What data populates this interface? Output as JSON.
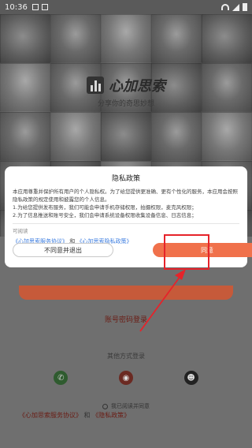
{
  "status_bar": {
    "time": "10:36"
  },
  "background": {
    "app_name": "心加思索",
    "tagline": "分享你的奇思妙想",
    "account_login": "账号密码登录",
    "other_login": "其他方式登录",
    "agree_text": "我已阅读并同意",
    "bottom_link1": "《心加思索服务协议》",
    "bottom_and": "和",
    "bottom_link2": "《隐私政策》",
    "social_icons": [
      "wechat-icon",
      "weibo-icon",
      "qq-icon"
    ]
  },
  "dialog": {
    "title": "隐私政策",
    "body": [
      "本应用尊重并保护所有用户的个人隐私权。为了给您提供更准确、更有个性化的服务，本应用会按照隐私政策的规定使用和披露您的个人信息。",
      "1.为给您提供发布服务，我们可能会申请手机存储权限，拍摄权限，麦克风权限；",
      "2.为了信息推送和账号安全，我们会申请系统设备权限收集设备信息、日志信息；"
    ],
    "read_label": "可阅读",
    "link1": "《心加思索服务协议》",
    "and": "和",
    "link2": "《心加思索隐私政策》",
    "disagree_label": "不同意并退出",
    "agree_label": "同意"
  },
  "colors": {
    "accent": "#f0714b",
    "highlight": "#e6232a",
    "link": "#3c7de0"
  }
}
